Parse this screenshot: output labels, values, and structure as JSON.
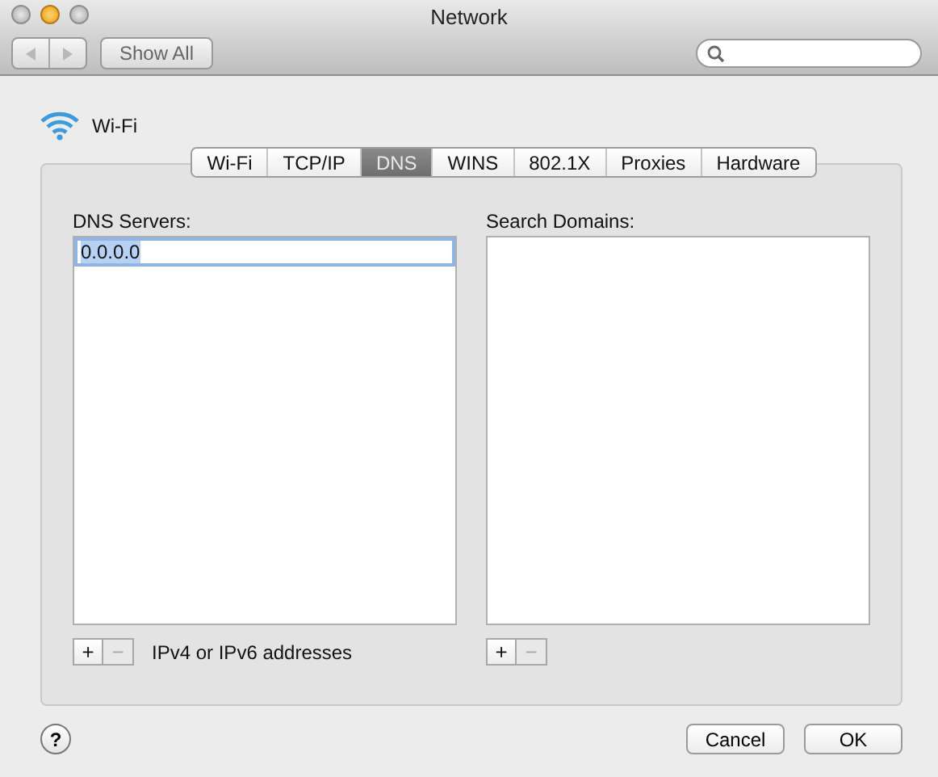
{
  "window": {
    "title": "Network"
  },
  "toolbar": {
    "show_all": "Show All"
  },
  "service": {
    "name": "Wi-Fi"
  },
  "tabs": [
    {
      "label": "Wi-Fi",
      "selected": false
    },
    {
      "label": "TCP/IP",
      "selected": false
    },
    {
      "label": "DNS",
      "selected": true
    },
    {
      "label": "WINS",
      "selected": false
    },
    {
      "label": "802.1X",
      "selected": false
    },
    {
      "label": "Proxies",
      "selected": false
    },
    {
      "label": "Hardware",
      "selected": false
    }
  ],
  "dns_servers": {
    "label": "DNS Servers:",
    "entries": [
      {
        "value": "0.0.0.0",
        "selected": true
      }
    ],
    "add": {
      "label": "+",
      "disabled": false
    },
    "remove": {
      "label": "−",
      "disabled": true
    },
    "hint": "IPv4 or IPv6 addresses"
  },
  "search_domains": {
    "label": "Search Domains:",
    "add": {
      "label": "+",
      "disabled": false
    },
    "remove": {
      "label": "−",
      "disabled": true
    }
  },
  "footer": {
    "help": "?",
    "buttons": [
      {
        "label": "Cancel"
      },
      {
        "label": "OK"
      }
    ]
  }
}
